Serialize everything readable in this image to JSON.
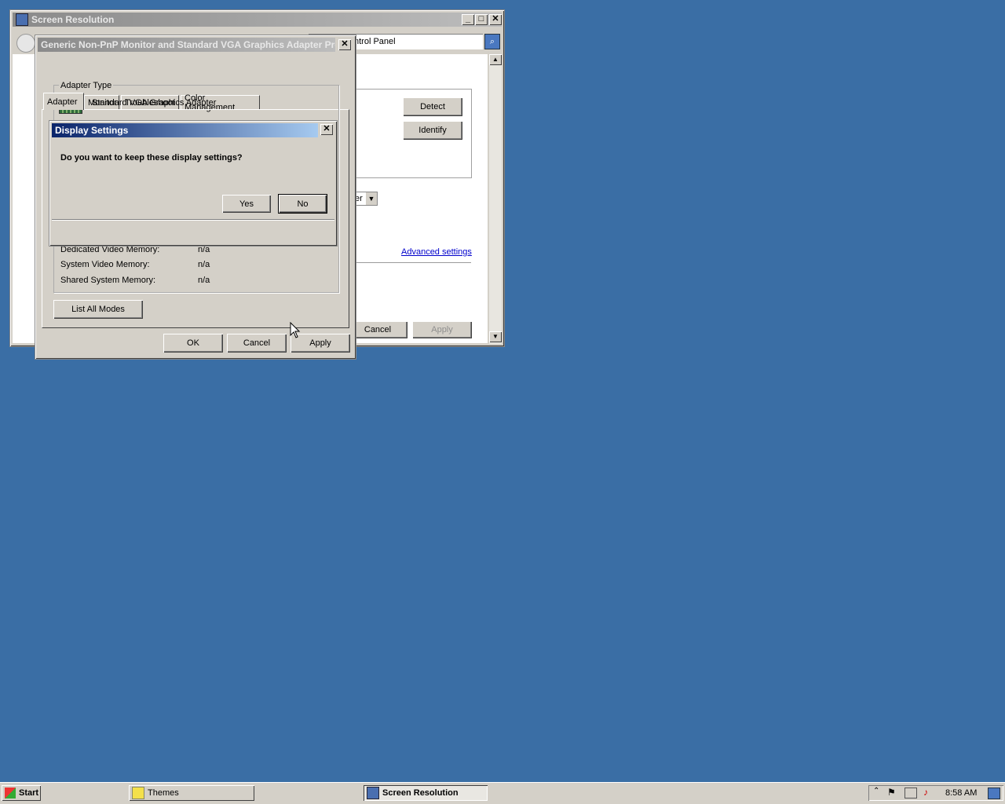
{
  "screen_resolution": {
    "title": "Screen Resolution",
    "address_text": "ntrol Panel",
    "buttons": {
      "detect": "Detect",
      "identify": "Identify",
      "cancel": "Cancel",
      "apply": "Apply"
    },
    "advanced_settings": "Advanced settings",
    "dropdown_partial": "er"
  },
  "adapter_props": {
    "title": "Generic Non-PnP Monitor and Standard VGA Graphics Adapter Pro...",
    "tabs": [
      "Adapter",
      "Monitor",
      "Troubleshoot",
      "Color Management"
    ],
    "adapter_type_label": "Adapter Type",
    "adapter_name": "Standard VGA Graphics Adapter",
    "memory": [
      {
        "label": "Dedicated Video Memory:",
        "value": "n/a"
      },
      {
        "label": "System Video Memory:",
        "value": "n/a"
      },
      {
        "label": "Shared System Memory:",
        "value": "n/a"
      }
    ],
    "list_all_modes": "List All Modes",
    "ok": "OK",
    "cancel": "Cancel",
    "apply": "Apply"
  },
  "display_settings": {
    "title": "Display Settings",
    "question": "Do you want to keep these display settings?",
    "yes": "Yes",
    "no": "No"
  },
  "taskbar": {
    "start": "Start",
    "items": [
      {
        "label": "Themes",
        "active": false
      },
      {
        "label": "Screen Resolution",
        "active": true
      }
    ],
    "clock": "8:58 AM"
  }
}
